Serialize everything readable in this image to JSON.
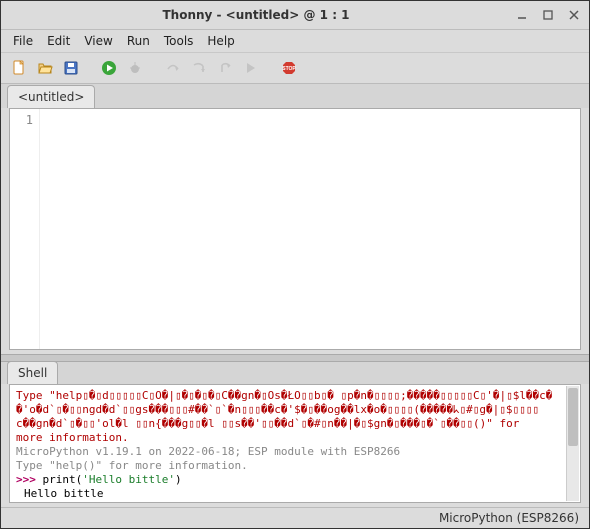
{
  "window": {
    "title": "Thonny - <untitled> @ 1 : 1"
  },
  "menus": {
    "file": "File",
    "edit": "Edit",
    "view": "View",
    "run": "Run",
    "tools": "Tools",
    "help": "Help"
  },
  "tab": {
    "name": "<untitled>"
  },
  "editor": {
    "line1_number": "1",
    "content_line1": ""
  },
  "shell_tab": {
    "name": "Shell"
  },
  "shell": {
    "garbled_line1": " Type \"help▯�▯d▯▯▯▯▯C▯O�|▯�▯�▯�▯C��gn�▯Os�ŁO▯▯b▯� ▯p�n�▯▯▯▯;�����▯▯▯▯▯C▯'�|▯$l��c�",
    "garbled_line2": "�'o�d`▯�▯▯ngd�d`▯▯gs���▯▯▯#��`▯`�n▯▯▯��c�'$�▯��og��lx�o�▯▯▯▯(�����ᖾ▯#▯g�|▯$▯▯▯▯",
    "garbled_line3": "c��gn�d`▯�▯▯'ol�l ▯▯n{���g▯▯�l ▯▯s��'▯▯��d`▯�#▯n��|�▯$gn�▯���▯�`▯��▯▯()\" for",
    "garbled_tail": "more information.",
    "version": "MicroPython v1.19.1 on 2022-06-18; ESP module with ESP8266",
    "info": "Type \"help()\" for more information.",
    "prompt1": ">>> ",
    "input1_pre": "print(",
    "input1_str": "'Hello bittle'",
    "input1_post": ")",
    "output1": "Hello bittle",
    "prompt2": ">>> "
  },
  "status": {
    "backend": "MicroPython (ESP8266)"
  }
}
